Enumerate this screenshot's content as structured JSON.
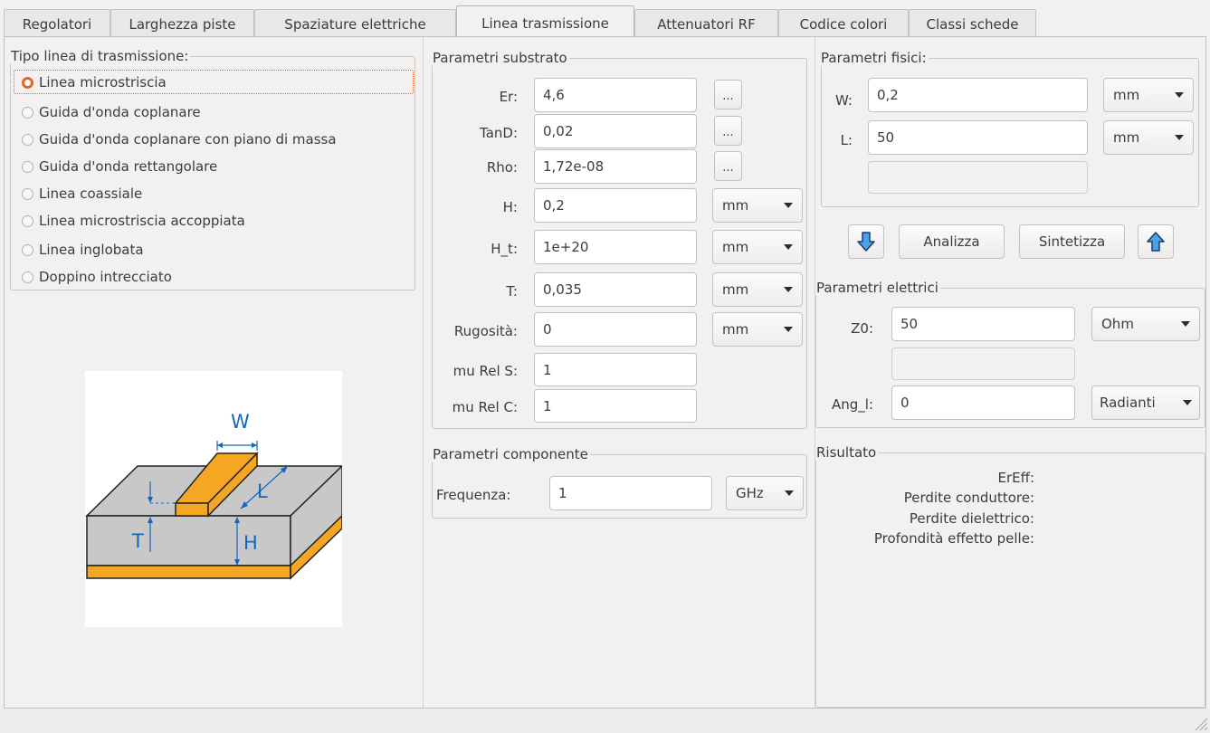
{
  "tabs": [
    "Regolatori",
    "Larghezza piste",
    "Spaziature elettriche",
    "Linea trasmissione",
    "Attenuatori RF",
    "Codice colori",
    "Classi schede"
  ],
  "active_tab": "Linea trasmissione",
  "line_type": {
    "title": "Tipo linea di trasmissione:",
    "options": [
      "Linea microstriscia",
      "Guida d'onda coplanare",
      "Guida d'onda coplanare con piano di massa",
      "Guida d'onda rettangolare",
      "Linea coassiale",
      "Linea microstriscia accoppiata",
      "Linea inglobata",
      "Doppino intrecciato"
    ],
    "selected": "Linea microstriscia"
  },
  "diagram": {
    "w": "W",
    "l": "L",
    "t": "T",
    "h": "H"
  },
  "substrate": {
    "title": "Parametri substrato",
    "er": {
      "label": "Er:",
      "value": "4,6"
    },
    "tand": {
      "label": "TanD:",
      "value": "0,02"
    },
    "rho": {
      "label": "Rho:",
      "value": "1,72e-08"
    },
    "h": {
      "label": "H:",
      "value": "0,2",
      "unit": "mm"
    },
    "h_t": {
      "label": "H_t:",
      "value": "1e+20",
      "unit": "mm"
    },
    "t": {
      "label": "T:",
      "value": "0,035",
      "unit": "mm"
    },
    "rough": {
      "label": "Rugosità:",
      "value": "0",
      "unit": "mm"
    },
    "mu_s": {
      "label": "mu Rel S:",
      "value": "1"
    },
    "mu_c": {
      "label": "mu Rel C:",
      "value": "1"
    },
    "ellipsis": "..."
  },
  "component": {
    "title": "Parametri componente",
    "freq": {
      "label": "Frequenza:",
      "value": "1",
      "unit": "GHz"
    }
  },
  "physical": {
    "title": "Parametri fisici:",
    "w": {
      "label": "W:",
      "value": "0,2",
      "unit": "mm"
    },
    "l": {
      "label": "L:",
      "value": "50",
      "unit": "mm"
    },
    "extra": ""
  },
  "actions": {
    "analyze": "Analizza",
    "synthesize": "Sintetizza",
    "down_icon": "arrow-down-icon",
    "up_icon": "arrow-up-icon"
  },
  "electrical": {
    "title": "Parametri elettrici",
    "z0": {
      "label": "Z0:",
      "value": "50",
      "unit": "Ohm"
    },
    "extra": "",
    "ang": {
      "label": "Ang_l:",
      "value": "0",
      "unit": "Radianti"
    }
  },
  "result": {
    "title": "Risultato",
    "labels": [
      "ErEff:",
      "Perdite conduttore:",
      "Perdite dielettrico:",
      "Profondità effetto pelle:"
    ]
  },
  "colors": {
    "accent": "#e5632f",
    "copper": "#f5a623",
    "substrate": "#c8c8c8",
    "arrow_blue": "#1e73be"
  }
}
